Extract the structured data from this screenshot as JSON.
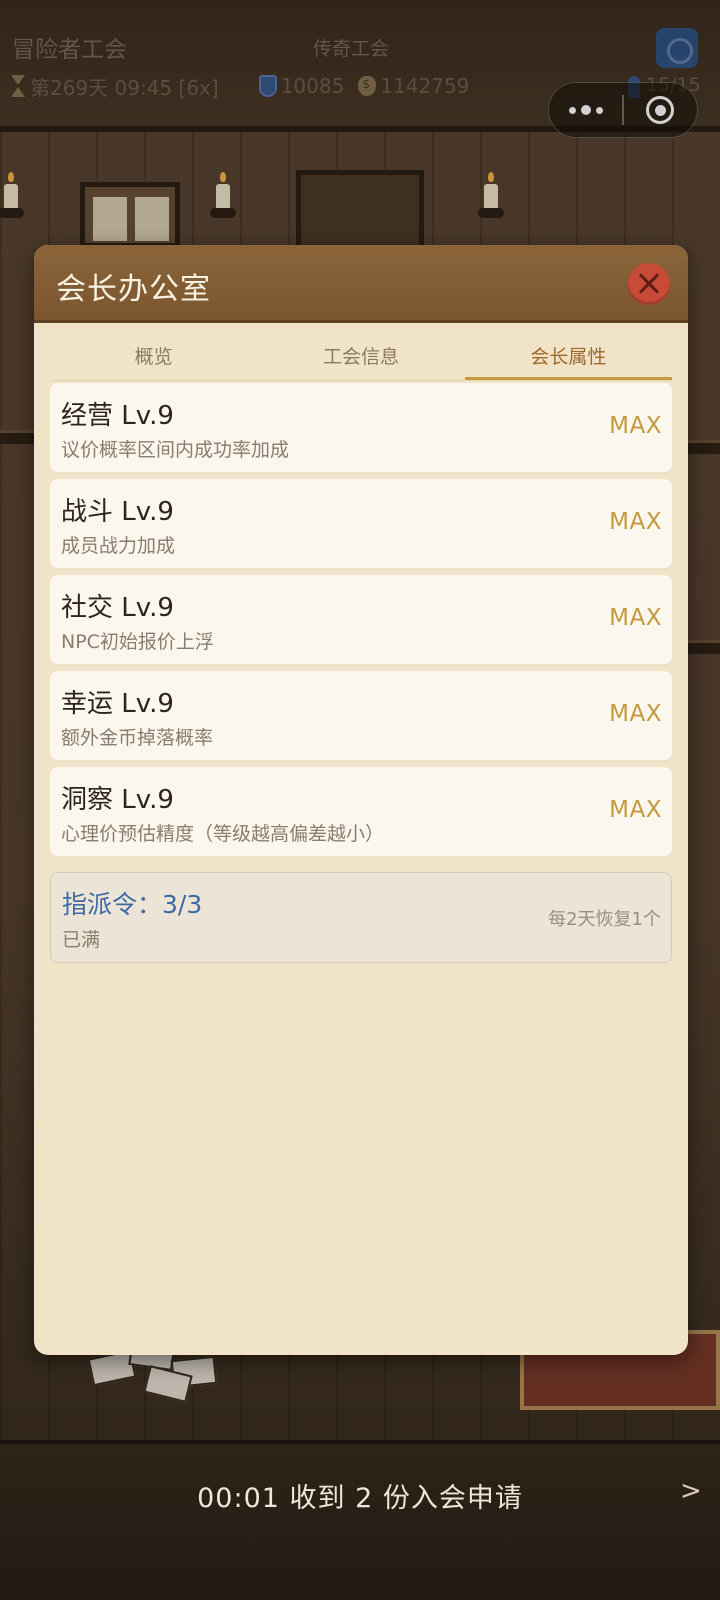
{
  "hud": {
    "guild_name": "冒险者工会",
    "guild_rank": "传奇工会",
    "day_time": "第269天 09:45 [6x]",
    "reputation": "10085",
    "gold": "1142759",
    "members": "15/15"
  },
  "modal": {
    "title": "会长办公室",
    "tabs": [
      {
        "label": "概览",
        "active": false
      },
      {
        "label": "工会信息",
        "active": false
      },
      {
        "label": "会长属性",
        "active": true
      }
    ],
    "attributes": [
      {
        "name": "经营 Lv.9",
        "description": "议价概率区间内成功率加成",
        "level_status": "MAX"
      },
      {
        "name": "战斗 Lv.9",
        "description": "成员战力加成",
        "level_status": "MAX"
      },
      {
        "name": "社交 Lv.9",
        "description": "NPC初始报价上浮",
        "level_status": "MAX"
      },
      {
        "name": "幸运 Lv.9",
        "description": "额外金币掉落概率",
        "level_status": "MAX"
      },
      {
        "name": "洞察 Lv.9",
        "description": "心理价预估精度（等级越高偏差越小）",
        "level_status": "MAX"
      }
    ],
    "dispatch_order": {
      "title": "指派令：3/3",
      "status": "已满",
      "recovery": "每2天恢复1个"
    }
  },
  "notice": {
    "text": "00:01 收到 2 份入会申请",
    "arrow": ">"
  },
  "colors": {
    "header_brown": "#7b5630",
    "panel_bg": "#f1e3c7",
    "card_bg": "#fbf7ef",
    "max_gold": "#c49a3a",
    "order_blue": "#3d6aa3",
    "close_red": "#c94a36",
    "tab_active": "#9c6a2e"
  }
}
